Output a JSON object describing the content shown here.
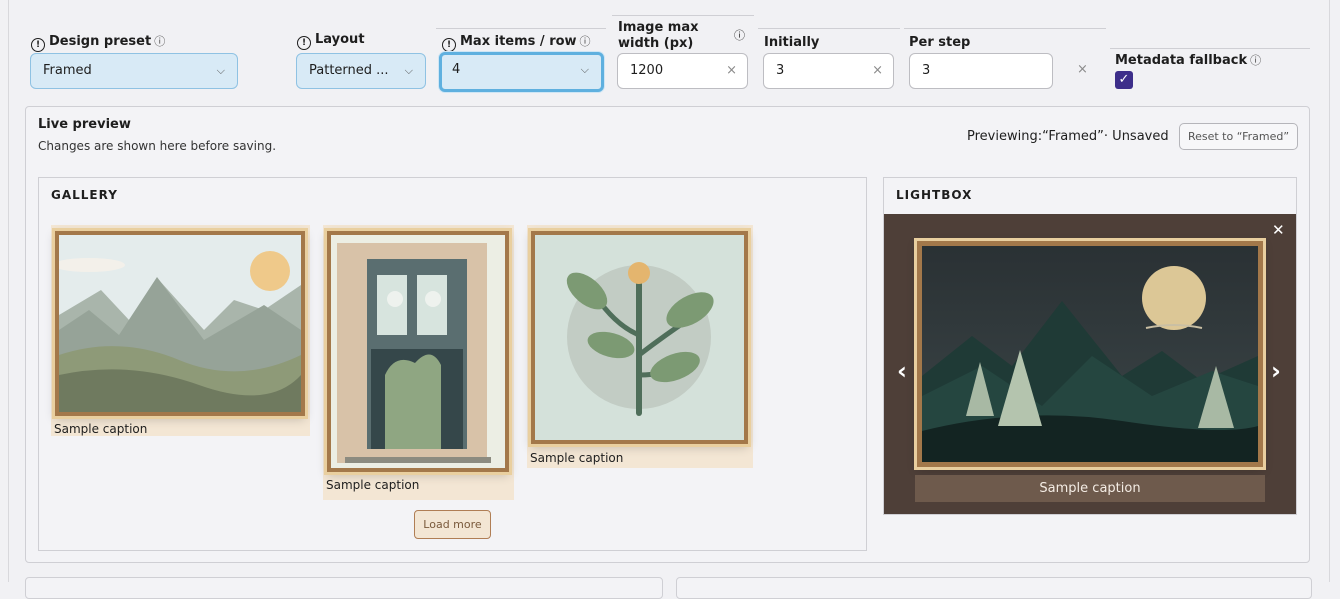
{
  "toolbar": {
    "design_preset": {
      "label": "Design preset",
      "value": "Framed"
    },
    "layout": {
      "label": "Layout",
      "value": "Patterned ..."
    },
    "max_items": {
      "label": "Max items / row",
      "value": "4"
    },
    "image_max_width": {
      "label_line1": "Image max",
      "label_line2": "width (px)",
      "value": "1200"
    },
    "initially": {
      "label": "Initially",
      "value": "3"
    },
    "per_step": {
      "label": "Per step",
      "value": "3"
    },
    "metadata_fallback": {
      "label": "Metadata fallback",
      "checked": true
    }
  },
  "glyphs": {
    "warn": "!",
    "info": "ⓘ",
    "chevron": "⌵",
    "clear": "×",
    "check": "✓",
    "close": "✕",
    "prev": "‹",
    "next": "›"
  },
  "preview": {
    "title": "Live preview",
    "subtitle": "Changes are shown here before saving.",
    "status": "Previewing:“Framed”· Unsaved",
    "reset_label": "Reset to “Framed”"
  },
  "gallery": {
    "title": "GALLERY",
    "items": [
      {
        "caption": "Sample caption",
        "subject": "mountain-landscape"
      },
      {
        "caption": "Sample caption",
        "subject": "doorway"
      },
      {
        "caption": "Sample caption",
        "subject": "plant"
      }
    ],
    "load_more_label": "Load more"
  },
  "lightbox": {
    "title": "LIGHTBOX",
    "caption": "Sample caption",
    "subject": "night-mountains"
  },
  "colors": {
    "accent_select": "#d8eaf6",
    "frame_wood": "#a3784a",
    "frame_gold": "#e9cf9f",
    "lightbox_bg": "#4e3f38",
    "checkbox": "#3d2e8a"
  }
}
